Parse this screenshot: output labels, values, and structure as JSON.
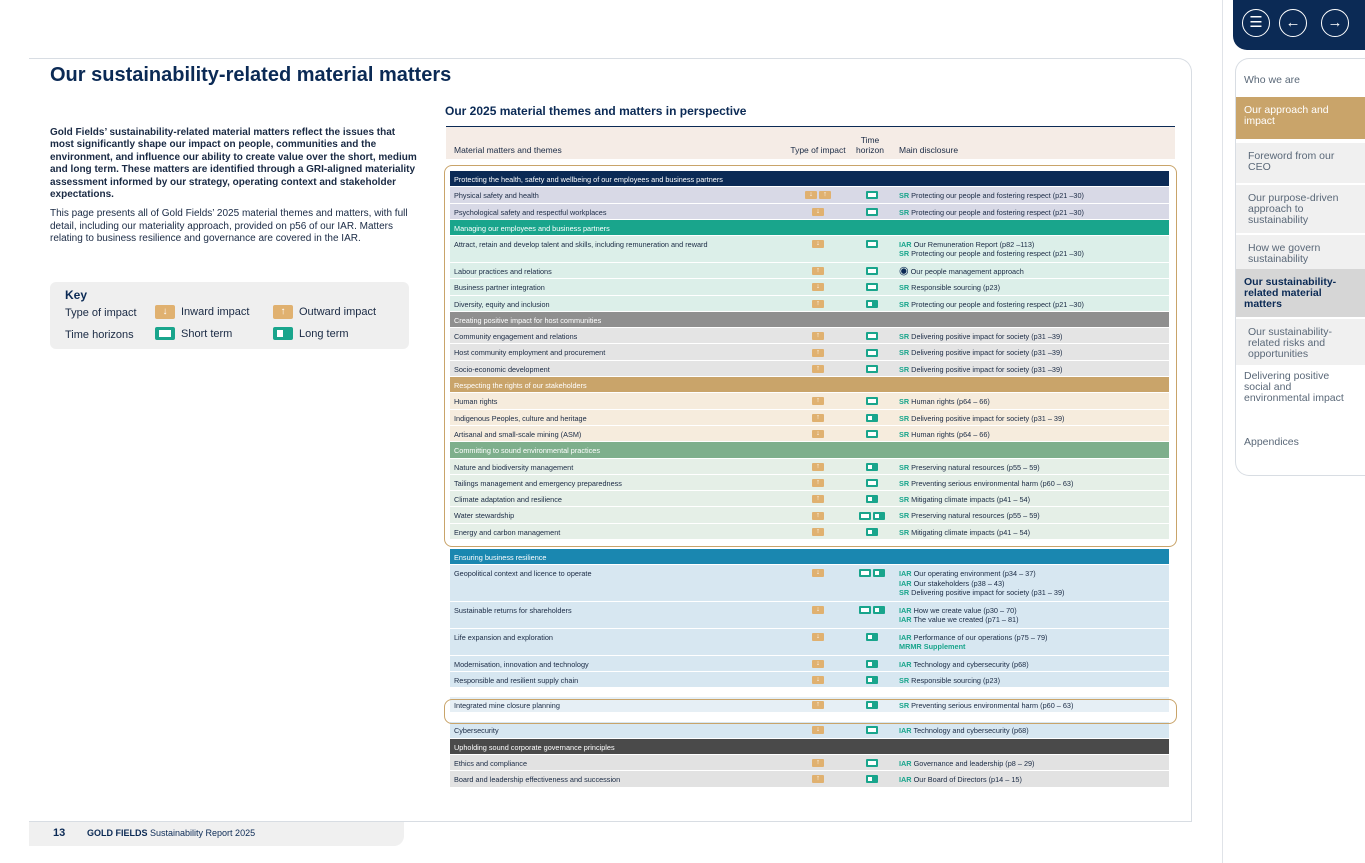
{
  "page": {
    "title": "Our sustainability-related material matters",
    "intro_bold": "Gold Fields’ sustainability-related material matters reflect the issues that most significantly shape our impact on people, communities and the environment, and influence our ability to create value over the short, medium and long term. These matters are identified through a GRI-aligned materiality assessment informed by our strategy, operating context and stakeholder expectations.",
    "intro_body": "This page presents all of Gold Fields’ 2025 material themes and matters, with full detail, including our materiality approach, provided on p56 of our IAR. Matters relating to business resilience and governance are covered in the IAR."
  },
  "key": {
    "title": "Key",
    "type_label": "Type of impact",
    "inward": "Inward impact",
    "outward": "Outward impact",
    "horizon_label": "Time horizons",
    "short": "Short term",
    "long": "Long term"
  },
  "table": {
    "title": "Our 2025 material themes and matters in perspective",
    "col_matter": "Material matters and themes",
    "col_type": "Type of impact",
    "col_horizon": "Time horizon",
    "col_disclosure": "Main disclosure"
  },
  "rows": [
    {
      "kind": "theme",
      "text": "Protecting the health, safety and wellbeing of our employees and business partners",
      "color": "#0b2a55"
    },
    {
      "kind": "row",
      "text": "Physical safety and health",
      "type": "in-out",
      "horizon": "short",
      "disc": [
        [
          "SR",
          "Protecting our people and fostering respect (p21 –30)"
        ]
      ],
      "bg": "#d8d9e6"
    },
    {
      "kind": "row",
      "text": "Psychological safety and respectful workplaces",
      "type": "in",
      "horizon": "short",
      "disc": [
        [
          "SR",
          "Protecting our people and fostering respect (p21 –30)"
        ]
      ],
      "bg": "#d8d9e6"
    },
    {
      "kind": "theme",
      "text": "Managing our employees and business partners",
      "color": "#19a58c"
    },
    {
      "kind": "row",
      "text": "Attract, retain and develop talent and skills, including remuneration and reward",
      "type": "in",
      "horizon": "short",
      "disc": [
        [
          "IAR",
          "Our Remuneration Report (p82 –113)"
        ],
        [
          "SR",
          "Protecting our people and fostering respect (p21 –30)"
        ]
      ],
      "bg": "#dcefe9",
      "h": 2
    },
    {
      "kind": "row",
      "text": "Labour practices and relations",
      "type": "out",
      "horizon": "short",
      "disc": [
        [
          "◉",
          "Our people management approach"
        ]
      ],
      "bg": "#dcefe9"
    },
    {
      "kind": "row",
      "text": "Business partner integration",
      "type": "in",
      "horizon": "short",
      "disc": [
        [
          "SR",
          "Responsible sourcing (p23)"
        ]
      ],
      "bg": "#dcefe9"
    },
    {
      "kind": "row",
      "text": "Diversity, equity and inclusion",
      "type": "out",
      "horizon": "long",
      "disc": [
        [
          "SR",
          "Protecting our people and fostering respect (p21 –30)"
        ]
      ],
      "bg": "#dcefe9"
    },
    {
      "kind": "theme",
      "text": "Creating positive impact for host communities",
      "color": "#8f8f8f"
    },
    {
      "kind": "row",
      "text": "Community engagement and relations",
      "type": "out",
      "horizon": "short",
      "disc": [
        [
          "SR",
          "Delivering positive impact for society (p31 –39)"
        ]
      ],
      "bg": "#e4e4e4"
    },
    {
      "kind": "row",
      "text": "Host community employment and procurement",
      "type": "out",
      "horizon": "short",
      "disc": [
        [
          "SR",
          "Delivering positive impact for society (p31 –39)"
        ]
      ],
      "bg": "#e4e4e4"
    },
    {
      "kind": "row",
      "text": "Socio-economic development",
      "type": "out",
      "horizon": "short",
      "disc": [
        [
          "SR",
          "Delivering positive impact for society (p31 –39)"
        ]
      ],
      "bg": "#e4e4e4"
    },
    {
      "kind": "theme",
      "text": "Respecting the rights of our stakeholders",
      "color": "#c9a46a"
    },
    {
      "kind": "row",
      "text": "Human rights",
      "type": "out",
      "horizon": "short",
      "disc": [
        [
          "SR",
          "Human rights (p64 – 66)"
        ]
      ],
      "bg": "#f6ecdd"
    },
    {
      "kind": "row",
      "text": "Indigenous Peoples, culture and heritage",
      "type": "out",
      "horizon": "long",
      "disc": [
        [
          "SR",
          "Delivering positive impact for society (p31 – 39)"
        ]
      ],
      "bg": "#f6ecdd"
    },
    {
      "kind": "row",
      "text": "Artisanal and small-scale mining (ASM)",
      "type": "in",
      "horizon": "short",
      "disc": [
        [
          "SR",
          "Human rights (p64 – 66)"
        ]
      ],
      "bg": "#f6ecdd"
    },
    {
      "kind": "theme",
      "text": "Committing to sound environmental practices",
      "color": "#7eaf8c"
    },
    {
      "kind": "row",
      "text": "Nature and biodiversity management",
      "type": "out",
      "horizon": "long",
      "disc": [
        [
          "SR",
          "Preserving natural resources (p55 – 59)"
        ]
      ],
      "bg": "#e5efe7"
    },
    {
      "kind": "row",
      "text": "Tailings management and emergency preparedness",
      "type": "out",
      "horizon": "short",
      "disc": [
        [
          "SR",
          "Preventing serious environmental harm (p60 – 63)"
        ]
      ],
      "bg": "#e5efe7"
    },
    {
      "kind": "row",
      "text": "Climate adaptation and resilience",
      "type": "out",
      "horizon": "long",
      "disc": [
        [
          "SR",
          "Mitigating climate impacts (p41 – 54)"
        ]
      ],
      "bg": "#e5efe7"
    },
    {
      "kind": "row",
      "text": "Water stewardship",
      "type": "out",
      "horizon": "short-long",
      "disc": [
        [
          "SR",
          "Preserving natural resources (p55 – 59)"
        ]
      ],
      "bg": "#e5efe7"
    },
    {
      "kind": "row",
      "text": "Energy and carbon management",
      "type": "out",
      "horizon": "long",
      "disc": [
        [
          "SR",
          "Mitigating climate impacts (p41 – 54)"
        ]
      ],
      "bg": "#e5efe7"
    },
    {
      "kind": "gap"
    },
    {
      "kind": "theme",
      "text": "Ensuring business resilience",
      "color": "#1a87b0"
    },
    {
      "kind": "row",
      "text": "Geopolitical context and licence to operate",
      "type": "in",
      "horizon": "short-long",
      "disc": [
        [
          "IAR",
          "Our operating environment (p34 – 37)"
        ],
        [
          "IAR",
          "Our stakeholders (p38 – 43)"
        ],
        [
          "SR",
          "Delivering positive impact for society (p31 – 39)"
        ]
      ],
      "bg": "#d7e7f1",
      "h": 3
    },
    {
      "kind": "row",
      "text": "Sustainable returns for shareholders",
      "type": "in",
      "horizon": "short-long",
      "disc": [
        [
          "IAR",
          "How we create value (p30 – 70)"
        ],
        [
          "IAR",
          "The value we created (p71 – 81)"
        ]
      ],
      "bg": "#d7e7f1",
      "h": 2
    },
    {
      "kind": "row",
      "text": "Life expansion and exploration",
      "type": "in",
      "horizon": "long",
      "disc": [
        [
          "IAR",
          "Performance of our operations (p75 – 79)"
        ],
        [
          "MRMR Supplement",
          ""
        ]
      ],
      "bg": "#d7e7f1",
      "h": 2
    },
    {
      "kind": "row",
      "text": "Modernisation, innovation and technology",
      "type": "in",
      "horizon": "long",
      "disc": [
        [
          "IAR",
          "Technology and cybersecurity (p68)"
        ]
      ],
      "bg": "#d7e7f1"
    },
    {
      "kind": "row",
      "text": "Responsible and resilient supply chain",
      "type": "in",
      "horizon": "long",
      "disc": [
        [
          "SR",
          "Responsible sourcing (p23)"
        ]
      ],
      "bg": "#d7e7f1"
    },
    {
      "kind": "gap"
    },
    {
      "kind": "row",
      "text": "Integrated mine closure planning",
      "type": "out",
      "horizon": "long",
      "disc": [
        [
          "SR",
          "Preventing serious environmental harm (p60 – 63)"
        ]
      ],
      "bg": "#e6eff5"
    },
    {
      "kind": "gap"
    },
    {
      "kind": "row",
      "text": "Cybersecurity",
      "type": "in",
      "horizon": "short",
      "disc": [
        [
          "IAR",
          "Technology and cybersecurity (p68)"
        ]
      ],
      "bg": "#d7e7f1"
    },
    {
      "kind": "theme",
      "text": "Upholding sound corporate governance principles",
      "color": "#4a4a4a"
    },
    {
      "kind": "row",
      "text": "Ethics and compliance",
      "type": "out",
      "horizon": "short",
      "disc": [
        [
          "IAR",
          "Governance and leadership (p8 – 29)"
        ]
      ],
      "bg": "#e2e2e2"
    },
    {
      "kind": "row",
      "text": "Board and leadership effectiveness and succession",
      "type": "out",
      "horizon": "long",
      "disc": [
        [
          "IAR",
          "Our Board of Directors (p14 – 15)"
        ]
      ],
      "bg": "#e2e2e2"
    }
  ],
  "footer": {
    "page_number": "13",
    "brand": "GOLD FIELDS",
    "report": "Sustainability Report 2025"
  },
  "nav": {
    "items": [
      {
        "label": "Who we are",
        "kind": "top"
      },
      {
        "label": "Our approach and impact",
        "kind": "active"
      },
      {
        "label": "Foreword from our CEO",
        "kind": "sub"
      },
      {
        "label": "Our purpose-driven approach to sustainability",
        "kind": "sub"
      },
      {
        "label": "How we govern sustainability",
        "kind": "sub"
      },
      {
        "label": "Our sustainability-related material matters",
        "kind": "current"
      },
      {
        "label": "Our sustainability-related risks and opportunities",
        "kind": "sub"
      },
      {
        "label": "Delivering positive social and environmental impact",
        "kind": "top"
      },
      {
        "label": "Appendices",
        "kind": "top"
      }
    ],
    "colors": {
      "active": "#c9a46a",
      "current": "#d6d6d6",
      "sub": "#f0f0f0",
      "navy": "#0b2a55"
    }
  }
}
